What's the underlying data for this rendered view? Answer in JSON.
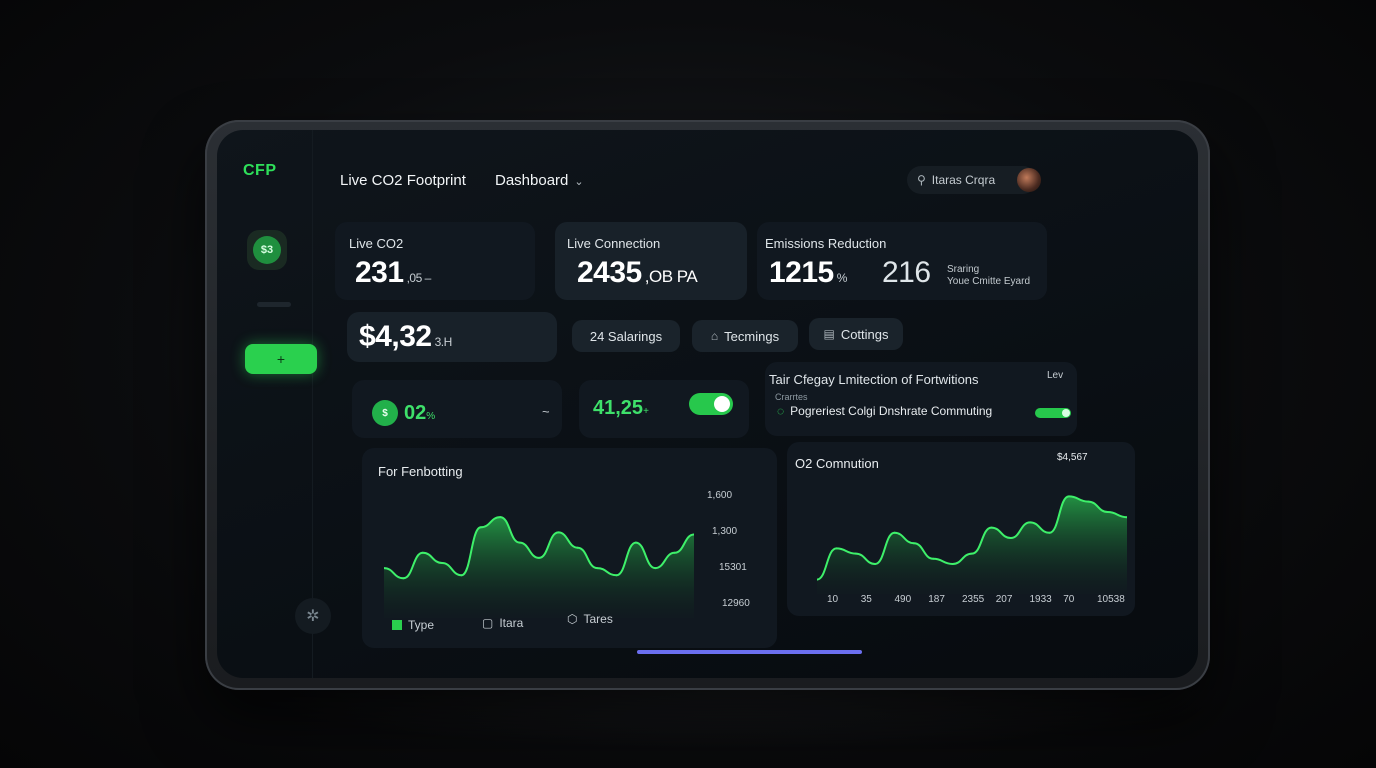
{
  "app": {
    "logo": "CFP",
    "title": "Live CO2 Footprint",
    "view": "Dashboard"
  },
  "sidebar": {
    "avatar_text": "$3"
  },
  "header": {
    "search_text": "Itaras Crqra"
  },
  "cards": {
    "live_co2": {
      "label": "Live CO2",
      "value": "231",
      "unit": ",05 –"
    },
    "live_connection": {
      "label": "Live Connection",
      "value": "2435",
      "unit": ",OB PA"
    },
    "emissions": {
      "label": "Emissions Reduction",
      "value": "1215",
      "unit": "%",
      "value2": "216",
      "note1": "Sraring",
      "note2": "Youe Cmitte Eyard"
    },
    "money": {
      "value": "$4,32",
      "unit": "3.H"
    }
  },
  "pills": [
    {
      "label": "24 Salarings"
    },
    {
      "label": "Tecmings"
    },
    {
      "label": "Cottings"
    }
  ],
  "status": {
    "left_badge": "$",
    "left_value": "02",
    "left_unit": "%",
    "left_chevron": "~",
    "mid_value": "41,25",
    "mid_unit": "+"
  },
  "notice": {
    "title": "Tair Cfegay Lmitection of Fortwitions",
    "side": "Lev",
    "sub": "Crarrtes",
    "line": "Pogreriest Colgi Dnshrate Commuting"
  },
  "chart_left": {
    "title": "For Fenbotting",
    "ticks": [
      "1,600",
      "1,300",
      "15301",
      "12960"
    ],
    "legend": [
      "Type",
      "Itara",
      "Tares"
    ]
  },
  "chart_right": {
    "title": "O2 Comnution",
    "corner": "$4,567",
    "ticks": [
      "10",
      "35",
      "490",
      "187",
      "2355",
      "207",
      "1933",
      "70",
      "10538"
    ]
  },
  "colors": {
    "accent": "#2ee05a",
    "bg": "#0a0f14",
    "home_bar": "#6b6ff0"
  },
  "chart_data": [
    {
      "type": "area",
      "title": "For Fenbotting",
      "x": [
        0,
        1,
        2,
        3,
        4,
        5,
        6,
        7,
        8,
        9,
        10,
        11,
        12,
        13,
        14,
        15,
        16
      ],
      "values": [
        0.45,
        0.35,
        0.6,
        0.5,
        0.38,
        0.85,
        0.95,
        0.7,
        0.55,
        0.8,
        0.65,
        0.45,
        0.38,
        0.7,
        0.45,
        0.6,
        0.78
      ],
      "yticks": [
        "1,600",
        "1,300",
        "15301",
        "12960"
      ],
      "legend": [
        "Type",
        "Itara",
        "Tares"
      ]
    },
    {
      "type": "area",
      "title": "O2 Comnution",
      "x": [
        0,
        1,
        2,
        3,
        4,
        5,
        6,
        7,
        8,
        9,
        10,
        11,
        12,
        13,
        14,
        15,
        16
      ],
      "values": [
        0.1,
        0.4,
        0.35,
        0.25,
        0.55,
        0.45,
        0.3,
        0.25,
        0.35,
        0.6,
        0.5,
        0.65,
        0.55,
        0.9,
        0.85,
        0.75,
        0.7
      ],
      "xticks": [
        "10",
        "35",
        "490",
        "187",
        "2355",
        "207",
        "1933",
        "70",
        "10538"
      ]
    }
  ]
}
